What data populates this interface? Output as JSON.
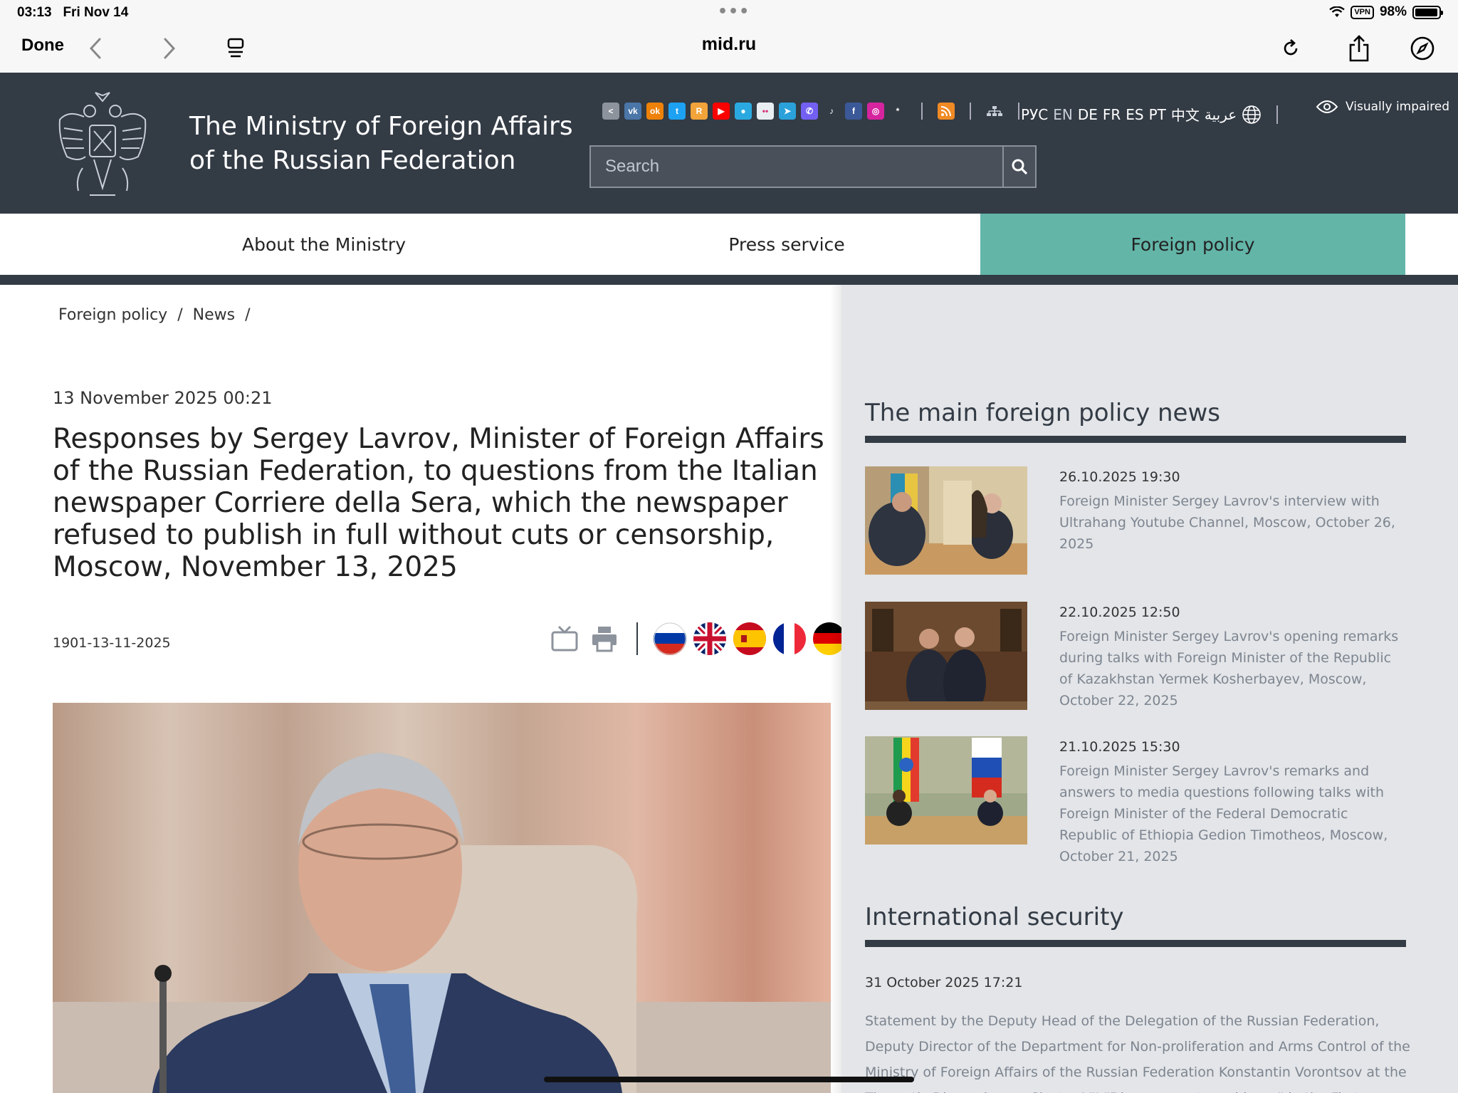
{
  "status": {
    "time": "03:13",
    "date": "Fri Nov 14",
    "vpn": "VPN",
    "battery": "98%",
    "battery_level": 0.98
  },
  "browser": {
    "done_label": "Done",
    "url": "mid.ru"
  },
  "site": {
    "title_line1": "The Ministry of Foreign Affairs",
    "title_line2": "of the Russian Federation",
    "visually_impaired": "Visually impaired",
    "search_placeholder": "Search",
    "languages": [
      "РУС",
      "EN",
      "DE",
      "FR",
      "ES",
      "PT",
      "中文",
      "عربية"
    ],
    "current_language": "EN",
    "social_icons": [
      {
        "name": "share-icon",
        "color": "#8d939c",
        "glyph": "<"
      },
      {
        "name": "vk-icon",
        "color": "#4a76a8",
        "glyph": "vk"
      },
      {
        "name": "odnoklassniki-icon",
        "color": "#ee8208",
        "glyph": "ok"
      },
      {
        "name": "twitter-icon",
        "color": "#1da1f2",
        "glyph": "t"
      },
      {
        "name": "rutube-icon",
        "color": "#f2a33a",
        "glyph": "R"
      },
      {
        "name": "youtube-icon",
        "color": "#ff0000",
        "glyph": "▶"
      },
      {
        "name": "map-pin-icon",
        "color": "#2aa9e0",
        "glyph": "●"
      },
      {
        "name": "flickr-icon",
        "color": "#e9eef3",
        "glyph": "••"
      },
      {
        "name": "telegram-icon",
        "color": "#2aa1da",
        "glyph": "➤"
      },
      {
        "name": "viber-icon",
        "color": "#7360f2",
        "glyph": "✆"
      },
      {
        "name": "tiktok-icon",
        "color": "#333b45",
        "glyph": "♪"
      },
      {
        "name": "facebook-icon",
        "color": "#3b5998",
        "glyph": "f"
      },
      {
        "name": "instagram-icon",
        "color": "#d6249f",
        "glyph": "◎"
      },
      {
        "name": "asterisk-icon",
        "color": "#333b45",
        "glyph": "*"
      }
    ]
  },
  "nav": {
    "items": [
      "About the Ministry",
      "Press service",
      "Foreign policy"
    ],
    "active": "Foreign policy"
  },
  "breadcrumb": [
    "Foreign policy",
    "/",
    "News",
    "/"
  ],
  "article": {
    "date": "13 November 2025 00:21",
    "title": "Responses by Sergey Lavrov, Minister of Foreign Affairs of the Russian Federation, to questions from the Italian newspaper Corriere della Sera, which the newspaper refused to publish in full without cuts or censorship, Moscow, November 13, 2025",
    "id": "1901-13-11-2025"
  },
  "sidebar": {
    "main_news_heading": "The main foreign policy news",
    "news": [
      {
        "date": "26.10.2025 19:30",
        "text": "Foreign Minister Sergey Lavrov's interview with Ultrahang Youtube Channel, Moscow, October 26, 2025"
      },
      {
        "date": "22.10.2025 12:50",
        "text": "Foreign Minister Sergey Lavrov's opening remarks during talks with Foreign Minister of the Republic of Kazakhstan Yermek Kosherbayev, Moscow, October 22, 2025"
      },
      {
        "date": "21.10.2025 15:30",
        "text": "Foreign Minister Sergey Lavrov's remarks and answers to media questions following talks with Foreign Minister of the Federal Democratic Republic of Ethiopia Gedion Timotheos, Moscow, October 21, 2025"
      }
    ],
    "security_heading": "International security",
    "security_date": "31 October 2025 17:21",
    "security_text": "Statement by the Deputy Head of the Delegation of the Russian Federation, Deputy Director of the Department for Non-proliferation and Arms Control of the Ministry of Foreign Affairs of the Russian Federation Konstantin Vorontsov at the Thematic Discussion on Cluster VII \"Disarmament machinery\" in the First Committee of the"
  },
  "colors": {
    "header_bg": "#333b45",
    "nav_active": "#63b5a8",
    "sidebar_bg": "#e3e5e8",
    "muted_text": "#7d8590"
  }
}
